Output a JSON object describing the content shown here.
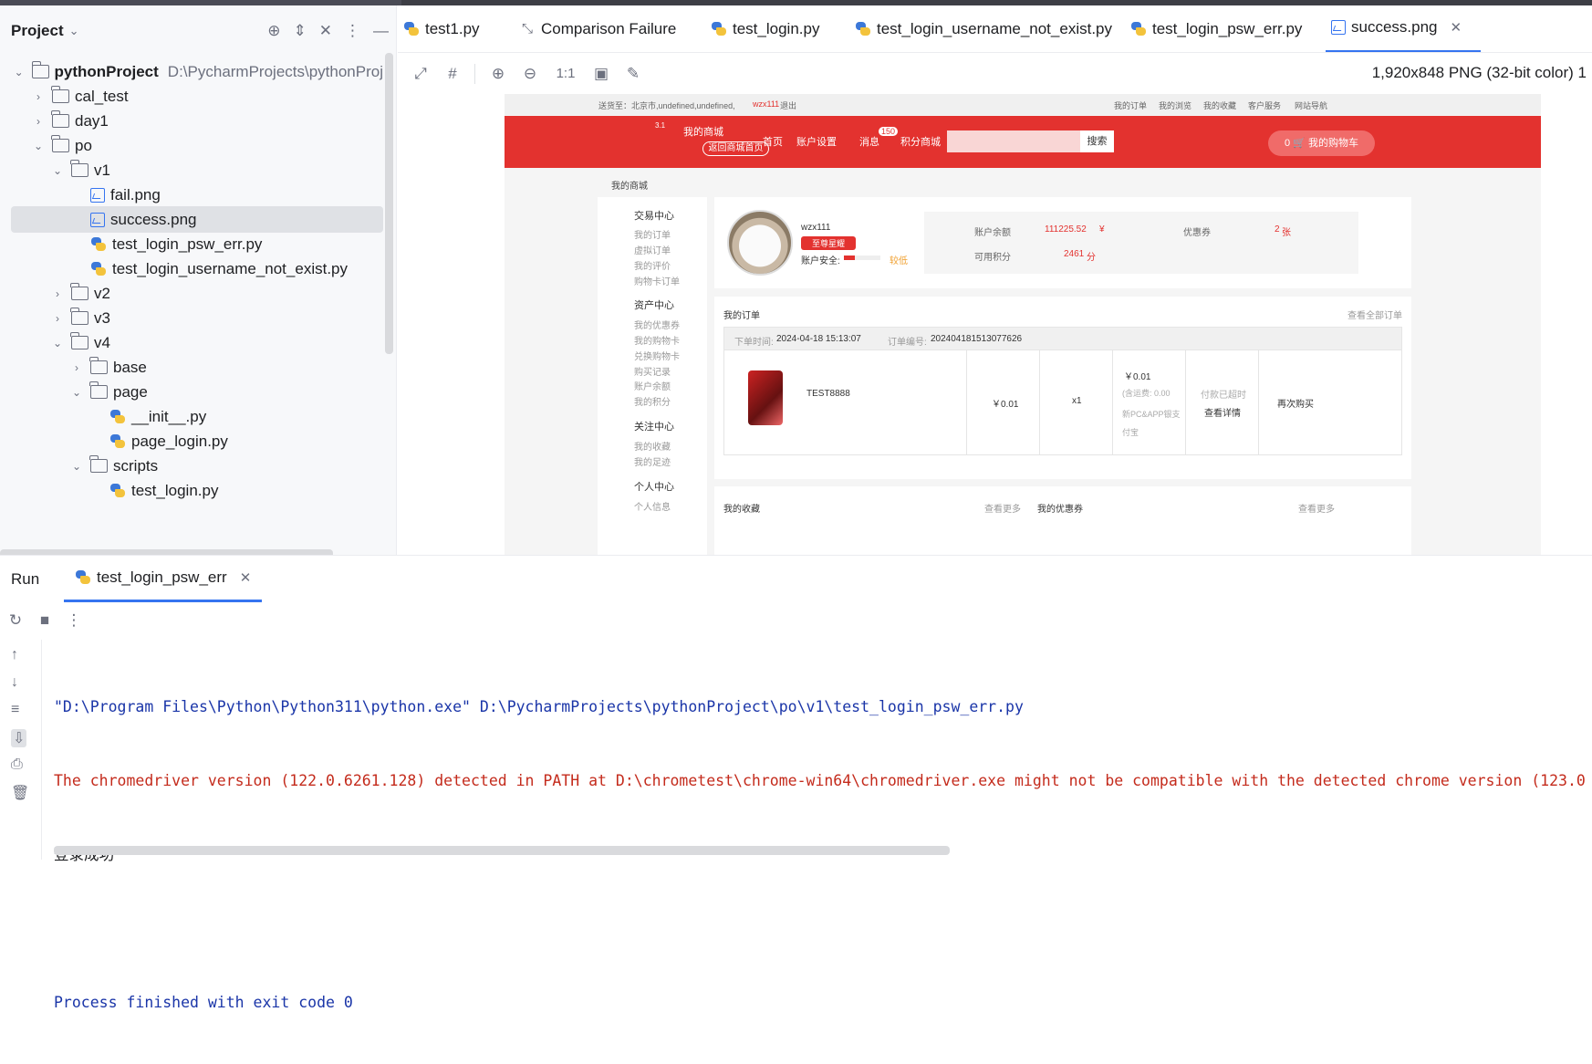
{
  "project": {
    "title": "Project",
    "tree": [
      {
        "label": "pythonProject",
        "path": "D:\\PycharmProjects\\pythonProj",
        "type": "folder",
        "bold": true
      },
      {
        "label": "cal_test",
        "type": "folder"
      },
      {
        "label": "day1",
        "type": "folder"
      },
      {
        "label": "po",
        "type": "folder"
      },
      {
        "label": "v1",
        "type": "folder"
      },
      {
        "label": "fail.png",
        "type": "image"
      },
      {
        "label": "success.png",
        "type": "image",
        "selected": true
      },
      {
        "label": "test_login_psw_err.py",
        "type": "python"
      },
      {
        "label": "test_login_username_not_exist.py",
        "type": "python"
      },
      {
        "label": "v2",
        "type": "folder"
      },
      {
        "label": "v3",
        "type": "folder"
      },
      {
        "label": "v4",
        "type": "folder"
      },
      {
        "label": "base",
        "type": "folder"
      },
      {
        "label": "page",
        "type": "package"
      },
      {
        "label": "__init__.py",
        "type": "python"
      },
      {
        "label": "page_login.py",
        "type": "python"
      },
      {
        "label": "scripts",
        "type": "folder"
      },
      {
        "label": "test_login.py",
        "type": "python"
      }
    ]
  },
  "tabs": [
    {
      "label": "test1.py",
      "icon": "python-icon"
    },
    {
      "label": "Comparison Failure",
      "icon": "compare-icon"
    },
    {
      "label": "test_login.py",
      "icon": "python-icon"
    },
    {
      "label": "test_login_username_not_exist.py",
      "icon": "python-icon"
    },
    {
      "label": "test_login_psw_err.py",
      "icon": "python-icon"
    },
    {
      "label": "success.png",
      "icon": "image-icon",
      "active": true
    }
  ],
  "image_toolbar": {
    "zoom_label": "1:1",
    "info": "1,920x848 PNG (32-bit color) 1"
  },
  "screenshot": {
    "top_bar": {
      "location": "送货至：北京市,undefined,undefined,",
      "user": "wzx111",
      "logout": "退出",
      "links": [
        "我的订单",
        "我的浏览",
        "我的收藏",
        "客户服务",
        "网站导航"
      ]
    },
    "header": {
      "version": "3.1",
      "mall": "我的商城",
      "back_home": "返回商城首页",
      "home": "首页",
      "account_settings": "账户设置",
      "messages": "消息",
      "message_count": "150",
      "points_mall": "积分商城",
      "search_btn": "搜索",
      "cart_count": "0",
      "cart": "我的购物车"
    },
    "breadcrumb": "我的商城",
    "menu": {
      "trade": "交易中心",
      "trade_items": [
        "我的订单",
        "虚拟订单",
        "我的评价",
        "购物卡订单"
      ],
      "assets": "资产中心",
      "asset_items": [
        "我的优惠券",
        "我的购物卡",
        "兑换购物卡",
        "购买记录",
        "账户余额",
        "我的积分"
      ],
      "follow": "关注中心",
      "follow_items": [
        "我的收藏",
        "我的足迹"
      ],
      "personal": "个人中心",
      "personal_items": [
        "个人信息"
      ]
    },
    "profile": {
      "username": "wzx111",
      "level": "至尊星耀",
      "security_label": "账户安全:",
      "security_level": "较低",
      "balance_label": "账户余额",
      "balance": "111225.52",
      "balance_unit": "¥",
      "coupon_label": "优惠券",
      "coupon_count": "2",
      "coupon_unit": "张",
      "points_label": "可用积分",
      "points": "2461",
      "points_unit": "分"
    },
    "orders": {
      "title": "我的订单",
      "view_all": "查看全部订单",
      "time_label": "下单时间:",
      "time": "2024-04-18 15:13:07",
      "number_label": "订单编号:",
      "number": "202404181513077626",
      "product": "TEST8888",
      "price": "￥0.01",
      "qty": "x1",
      "total": "￥0.01",
      "shipping": "(含运费:  0.00",
      "payment": "新PC&APP银支付宝",
      "status": "付款已超时",
      "detail": "查看详情",
      "buy_again": "再次购买"
    },
    "favorites": {
      "title": "我的收藏",
      "more": "查看更多"
    },
    "coupons": {
      "title": "我的优惠券",
      "more": "查看更多"
    }
  },
  "run": {
    "label": "Run",
    "tab": "test_login_psw_err",
    "console": {
      "cmd": "\"D:\\Program Files\\Python\\Python311\\python.exe\" D:\\PycharmProjects\\pythonProject\\po\\v1\\test_login_psw_err.py",
      "warning": "The chromedriver version (122.0.6261.128) detected in PATH at D:\\chrometest\\chrome-win64\\chromedriver.exe might not be compatible with the detected chrome version (123.0",
      "output": "登录成功",
      "finish": "Process finished with exit code 0"
    }
  }
}
